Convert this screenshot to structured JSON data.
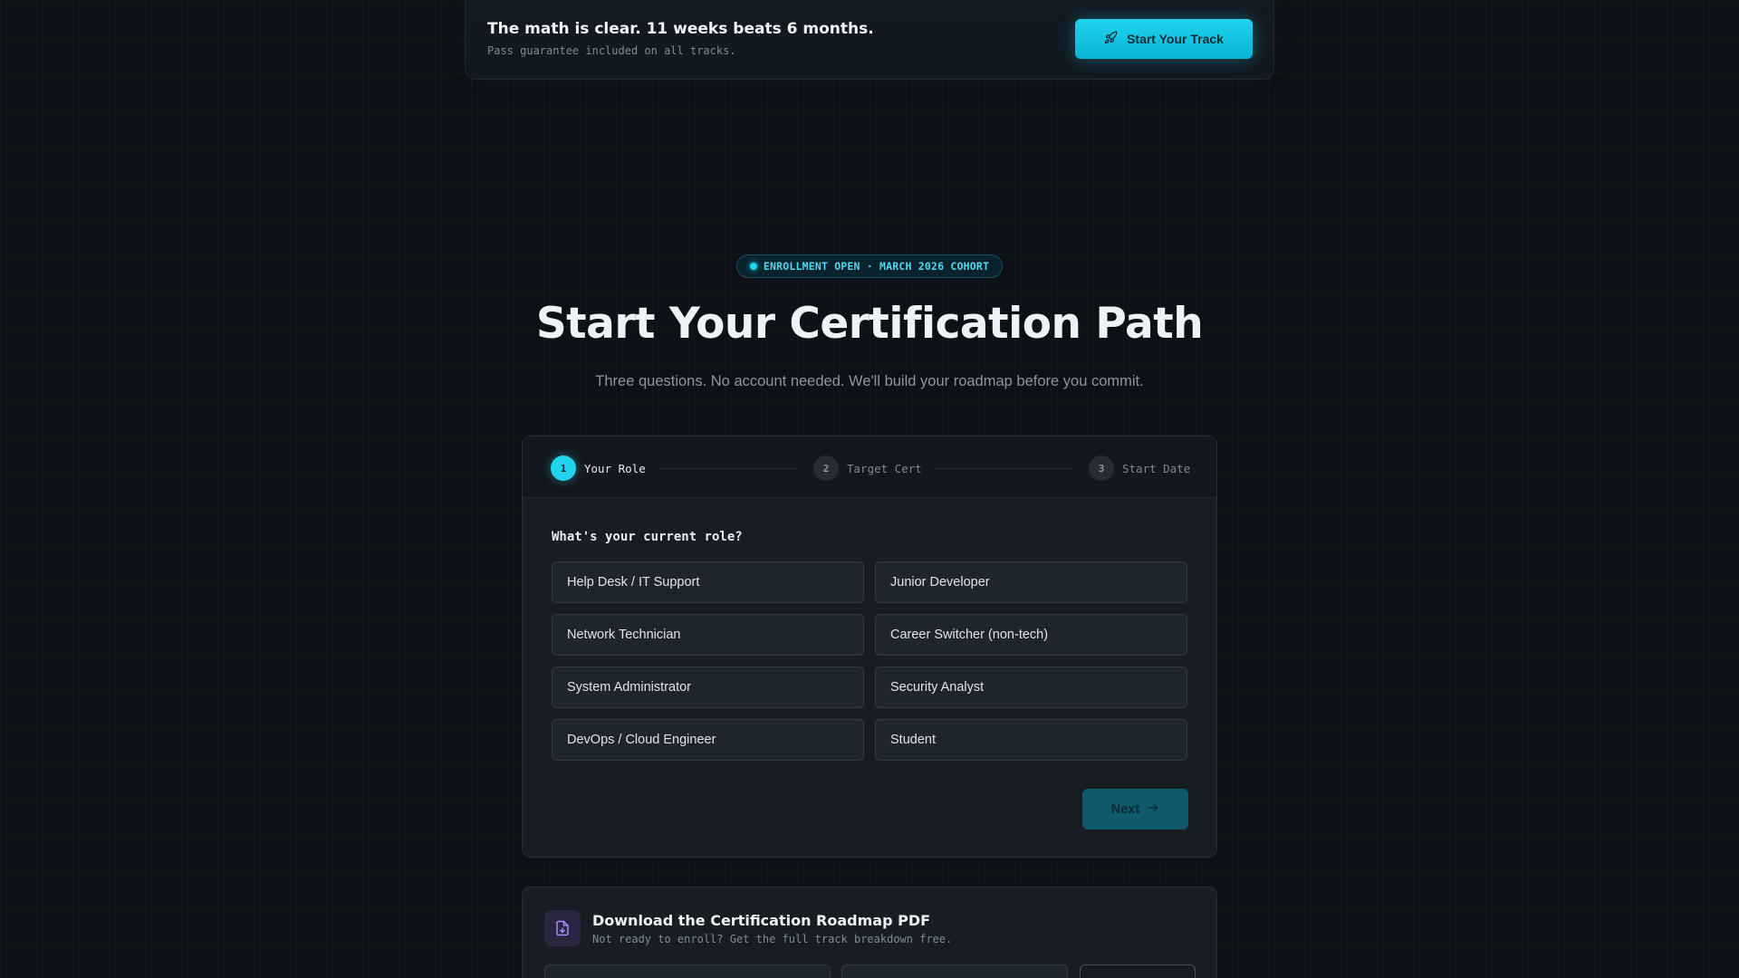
{
  "banner": {
    "title": "The math is clear. 11 weeks beats 6 months.",
    "subtitle": "Pass guarantee included on all tracks.",
    "cta_label": "Start Your Track",
    "cta_icon": "rocket-icon"
  },
  "hero": {
    "badge": "ENROLLMENT OPEN · MARCH 2026 COHORT",
    "title": "Start Your Certification Path",
    "subtitle": "Three questions. No account needed. We'll build your roadmap before you commit."
  },
  "wizard": {
    "steps": [
      {
        "num": "1",
        "label": "Your Role",
        "active": true
      },
      {
        "num": "2",
        "label": "Target Cert",
        "active": false
      },
      {
        "num": "3",
        "label": "Start Date",
        "active": false
      }
    ],
    "question": "What's your current role?",
    "options": [
      "Help Desk / IT Support",
      "Junior Developer",
      "Network Technician",
      "Career Switcher (non-tech)",
      "System Administrator",
      "Security Analyst",
      "DevOps / Cloud Engineer",
      "Student"
    ],
    "next_label": "Next",
    "next_icon": "arrow-right-icon"
  },
  "pdf": {
    "icon": "file-download-icon",
    "title": "Download the Certification Roadmap PDF",
    "subtitle": "Not ready to enroll? Get the full track breakdown free."
  },
  "colors": {
    "accent": "#22d3ee",
    "background": "#0d1016",
    "card": "#181d24"
  }
}
